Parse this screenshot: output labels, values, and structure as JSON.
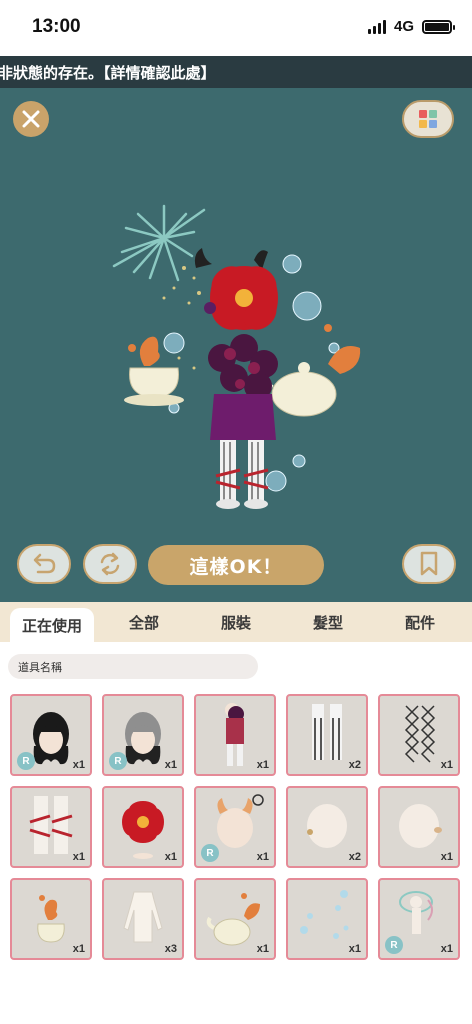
{
  "status": {
    "time": "13:00",
    "network": "4G"
  },
  "banner": {
    "text": "非狀態的存在。【詳情確認此處】"
  },
  "controls": {
    "ok_label": "這樣OK！"
  },
  "tabs": [
    {
      "label": "正在使用"
    },
    {
      "label": "全部"
    },
    {
      "label": "服裝"
    },
    {
      "label": "髮型"
    },
    {
      "label": "配件"
    }
  ],
  "item_name_label": "道具名稱",
  "items": [
    {
      "icon": "black-hair-icon",
      "count": "x1",
      "rarity": "R"
    },
    {
      "icon": "grey-black-hair-icon",
      "count": "x1",
      "rarity": "R"
    },
    {
      "icon": "dress-outfit-icon",
      "count": "x1"
    },
    {
      "icon": "striped-socks-icon",
      "count": "x2"
    },
    {
      "icon": "fishnet-stockings-icon",
      "count": "x1"
    },
    {
      "icon": "ribbon-legwear-icon",
      "count": "x1"
    },
    {
      "icon": "red-flower-headpiece-icon",
      "count": "x1"
    },
    {
      "icon": "horns-accessory-icon",
      "count": "x1",
      "rarity": "R"
    },
    {
      "icon": "earring-accessory-icon",
      "count": "x2"
    },
    {
      "icon": "head-accessory-icon",
      "count": "x1"
    },
    {
      "icon": "teacup-effect-icon",
      "count": "x1"
    },
    {
      "icon": "white-top-icon",
      "count": "x3"
    },
    {
      "icon": "teapot-effect-icon",
      "count": "x1"
    },
    {
      "icon": "bubbles-effect-icon",
      "count": "x1"
    },
    {
      "icon": "aura-effect-icon",
      "count": "x1",
      "rarity": "R"
    }
  ]
}
